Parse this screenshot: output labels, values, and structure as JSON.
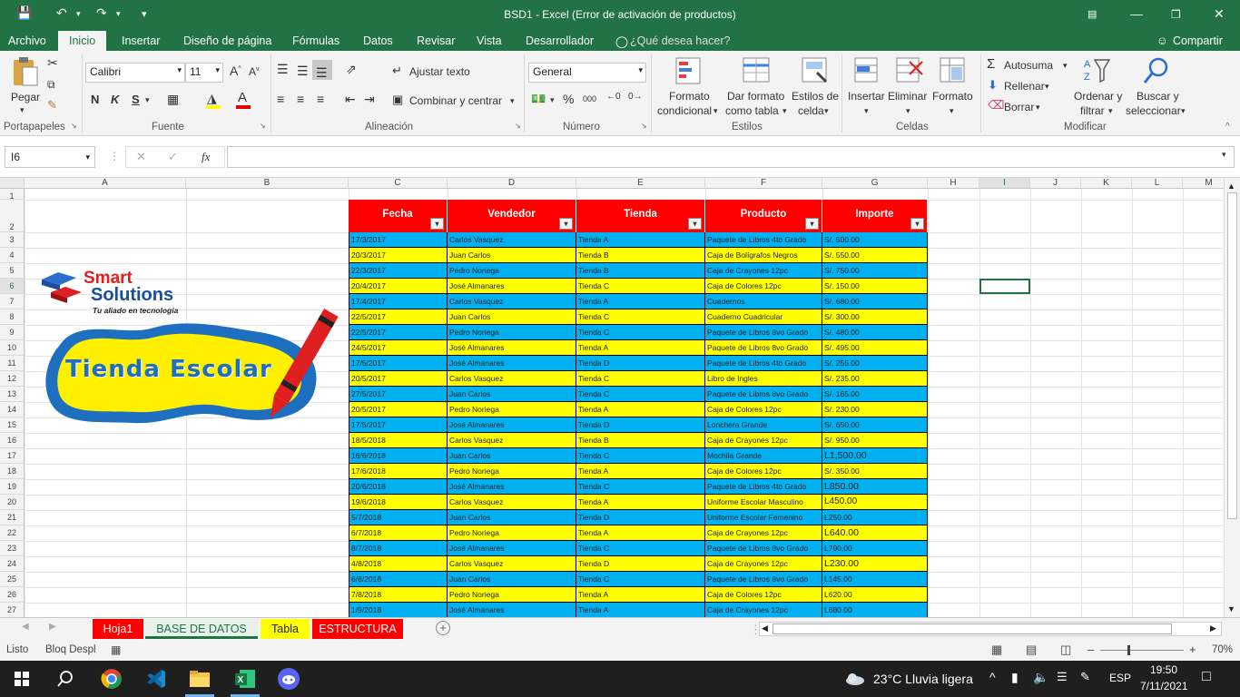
{
  "window": {
    "title": "BSD1 - Excel (Error de activación de productos)"
  },
  "menu": {
    "items": [
      "Archivo",
      "Inicio",
      "Insertar",
      "Diseño de página",
      "Fórmulas",
      "Datos",
      "Revisar",
      "Vista",
      "Desarrollador"
    ],
    "search": "¿Qué desea hacer?",
    "share": "Compartir"
  },
  "ribbon": {
    "paste": "Pegar",
    "font_name": "Calibri",
    "font_size": "11",
    "bold": "N",
    "italic": "K",
    "underline": "S",
    "wrap": "Ajustar texto",
    "merge": "Combinar y centrar",
    "number_format": "General",
    "percent": "%",
    "thousands": "000",
    "cond_format": [
      "Formato",
      "condicional"
    ],
    "table_format": [
      "Dar formato",
      "como tabla"
    ],
    "cell_styles": [
      "Estilos de",
      "celda"
    ],
    "insert": "Insertar",
    "delete": "Eliminar",
    "format": "Formato",
    "autosum": "Autosuma",
    "fill": "Rellenar",
    "clear": "Borrar",
    "sort": [
      "Ordenar y",
      "filtrar"
    ],
    "find": [
      "Buscar y",
      "seleccionar"
    ],
    "groups": [
      "Portapapeles",
      "Fuente",
      "Alineación",
      "Número",
      "Estilos",
      "Celdas",
      "Modificar"
    ]
  },
  "formula_bar": {
    "name_box": "I6",
    "fx": "fx",
    "value": ""
  },
  "columns": [
    "A",
    "B",
    "C",
    "D",
    "E",
    "F",
    "G",
    "H",
    "I",
    "J",
    "K",
    "L",
    "M"
  ],
  "rows": [
    "1",
    "2",
    "3",
    "4",
    "5",
    "6",
    "7",
    "8",
    "9",
    "10",
    "11",
    "12",
    "13",
    "14",
    "15",
    "16",
    "17",
    "18",
    "19",
    "20",
    "21",
    "22",
    "23",
    "24",
    "25",
    "26",
    "27"
  ],
  "logo": {
    "brand1": "Smart",
    "brand2": "Solutions",
    "tagline": "Tu aliado en tecnologia",
    "store": "Tienda Escolar"
  },
  "table": {
    "headers": [
      "Fecha",
      "Vendedor",
      "Tienda",
      "Producto",
      "Importe"
    ],
    "filter_glyph": "▾",
    "rows": [
      [
        "17/3/2017",
        "Carlos Vasquez",
        "Tienda A",
        "Paquete de Libros 4to Grado",
        "S/. 500.00"
      ],
      [
        "20/3/2017",
        "Juan Carlos",
        "Tienda B",
        "Caja de Bolígrafos Negros",
        "S/. 550.00"
      ],
      [
        "22/3/2017",
        "Pedro Noriega",
        "Tienda B",
        "Caja de Crayones 12pc",
        "S/. 750.00"
      ],
      [
        "20/4/2017",
        "José Almanares",
        "Tienda C",
        "Caja de Colores 12pc",
        "S/. 150.00"
      ],
      [
        "17/4/2017",
        "Carlos Vasquez",
        "Tienda A",
        "Cuadernos",
        "S/. 680.00"
      ],
      [
        "22/5/2017",
        "Juan Carlos",
        "Tienda C",
        "Cuaderno Cuadricular",
        "S/. 300.00"
      ],
      [
        "22/5/2017",
        "Pedro Noriega",
        "Tienda C",
        "Paquete de Libros 8vo Grado",
        "S/. 480.00"
      ],
      [
        "24/5/2017",
        "José Almanares",
        "Tienda A",
        "Paquete de Libros 8vo Grado",
        "S/. 495.00"
      ],
      [
        "17/5/2017",
        "José Almanares",
        "Tienda D",
        "Paquete de Libros 4to Grado",
        "S/. 255.00"
      ],
      [
        "20/5/2017",
        "Carlos Vasquez",
        "Tienda C",
        "Libro de Ingles",
        "S/. 235.00"
      ],
      [
        "27/5/2017",
        "Juan Carlos",
        "Tienda C",
        "Paquete de Libros 8vo Grado",
        "S/. 165.00"
      ],
      [
        "20/5/2017",
        "Pedro Noriega",
        "Tienda A",
        "Caja de Colores 12pc",
        "S/. 230.00"
      ],
      [
        "17/5/2017",
        "José Almanares",
        "Tienda D",
        "Lonchera Grande",
        "S/. 650.00"
      ],
      [
        "18/5/2018",
        "Carlos Vasquez",
        "Tienda B",
        "Caja de Crayones 12pc",
        "S/. 950.00"
      ],
      [
        "16/6/2018",
        "Juan Carlos",
        "Tienda C",
        "Mochila Grande",
        "L1,500.00"
      ],
      [
        "17/6/2018",
        "Pedro Noriega",
        "Tienda A",
        "Caja de Colores 12pc",
        "S/. 350.00"
      ],
      [
        "20/6/2018",
        "José Almanares",
        "Tienda C",
        "Paquete de Libros 4to Grado",
        "L850.00"
      ],
      [
        "19/6/2018",
        "Carlos Vasquez",
        "Tienda A",
        "Uniforme Escolar Masculino",
        "L450.00"
      ],
      [
        "5/7/2018",
        "Juan Carlos",
        "Tienda D",
        "Uniforme Escolar Femenino",
        "L250.00"
      ],
      [
        "6/7/2018",
        "Pedro Noriega",
        "Tienda A",
        "Caja de Crayones 12pc",
        "L640.00"
      ],
      [
        "8/7/2018",
        "José Almanares",
        "Tienda C",
        "Paquete de Libros 8vo Grado",
        "L790.00"
      ],
      [
        "4/8/2018",
        "Carlos Vasquez",
        "Tienda D",
        "Caja de Crayones 12pc",
        "L230.00"
      ],
      [
        "6/8/2018",
        "Juan Carlos",
        "Tienda C",
        "Paquete de Libros 8vo Grado",
        "L145.00"
      ],
      [
        "7/8/2018",
        "Pedro Noriega",
        "Tienda A",
        "Caja de Colores 12pc",
        "L620.00"
      ],
      [
        "1/9/2018",
        "José Almanares",
        "Tienda A",
        "Caja de Crayones 12pc",
        "L680.00"
      ]
    ]
  },
  "sheets": [
    {
      "name": "Hoja1",
      "color": "#ff0000"
    },
    {
      "name": "BASE DE DATOS",
      "color": "#ffffff"
    },
    {
      "name": "Tabla",
      "color": "#ffff00"
    },
    {
      "name": "ESTRUCTURA",
      "color": "#ff0000"
    }
  ],
  "status": {
    "ready": "Listo",
    "scroll": "Bloq Despl",
    "zoom": "70%"
  },
  "taskbar": {
    "weather": "23°C  Lluvia ligera",
    "lang": "ESP",
    "time": "19:50",
    "date": "7/11/2021"
  },
  "colors": {
    "excel_green": "#217346",
    "blue_row": "#00b0f0",
    "yellow_row": "#ffff00",
    "header_red": "#ff0000"
  }
}
